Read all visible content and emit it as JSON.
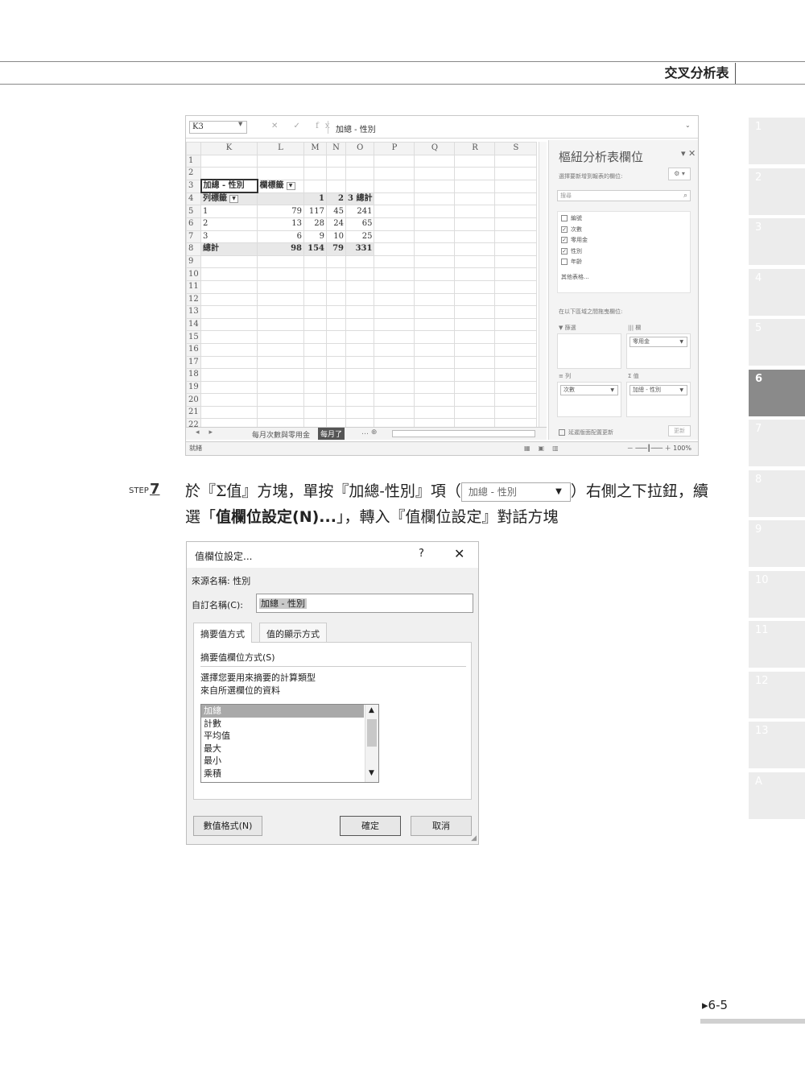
{
  "header": {
    "title": "交叉分析表"
  },
  "chapter_tabs": [
    "1",
    "2",
    "3",
    "4",
    "5",
    "6",
    "7",
    "8",
    "9",
    "10",
    "11",
    "12",
    "13",
    "A"
  ],
  "chapter_active": "6",
  "excel": {
    "name_box": "K3",
    "formula_icons": "✕ ✓ fx",
    "formula_text": "加總 - 性別",
    "col_headers": [
      "K",
      "L",
      "M",
      "N",
      "O",
      "P",
      "Q",
      "R",
      "S"
    ],
    "rows": [
      {
        "n": "1",
        "c": [
          "",
          "",
          "",
          "",
          ""
        ]
      },
      {
        "n": "2",
        "c": [
          "",
          "",
          "",
          "",
          ""
        ]
      },
      {
        "n": "3",
        "c": [
          "加總 - 性別",
          "欄標籤",
          "",
          "",
          ""
        ]
      },
      {
        "n": "4",
        "c": [
          "列標籤",
          "",
          "1",
          "2",
          "3 總計"
        ]
      },
      {
        "n": "5",
        "c": [
          "1",
          "79",
          "117",
          "45",
          "241"
        ]
      },
      {
        "n": "6",
        "c": [
          "2",
          "13",
          "28",
          "24",
          "65"
        ]
      },
      {
        "n": "7",
        "c": [
          "3",
          "6",
          "9",
          "10",
          "25"
        ]
      },
      {
        "n": "8",
        "c": [
          "總計",
          "98",
          "154",
          "79",
          "331"
        ]
      },
      {
        "n": "9"
      },
      {
        "n": "10"
      },
      {
        "n": "11"
      },
      {
        "n": "12"
      },
      {
        "n": "13"
      },
      {
        "n": "14"
      },
      {
        "n": "15"
      },
      {
        "n": "16"
      },
      {
        "n": "17"
      },
      {
        "n": "18"
      },
      {
        "n": "19"
      },
      {
        "n": "20"
      },
      {
        "n": "21"
      },
      {
        "n": "22"
      }
    ],
    "sheet_tabs": [
      "每月次數與零用金",
      "每月了"
    ],
    "status": "就緒",
    "zoom": "100%",
    "pane": {
      "title": "樞紐分析表欄位",
      "subtitle": "選擇要新增到報表的欄位:",
      "search_placeholder": "搜尋",
      "fields": [
        {
          "label": "編號",
          "checked": false
        },
        {
          "label": "次數",
          "checked": true
        },
        {
          "label": "零用金",
          "checked": true
        },
        {
          "label": "性別",
          "checked": true
        },
        {
          "label": "年齡",
          "checked": false
        }
      ],
      "more_tables": "其他表格...",
      "areas_label": "在以下區域之間拖曳欄位:",
      "filters_label": "▼ 篩選",
      "columns_label": "||| 欄",
      "columns_chip": "零用金",
      "rows_label": "≡ 列",
      "rows_chip": "次數",
      "values_label": "Σ 值",
      "values_chip": "加總 - 性別",
      "defer_label": "延遲版面配置更新",
      "update_label": "更新"
    }
  },
  "step": {
    "label": "STEP",
    "number": "7",
    "text_part1": "於『Σ值』方塊，單按『加總-性別』項（",
    "chip_text": "加總 - 性別",
    "text_part2": "）右側之下拉鈕，續選「",
    "bold_text": "值欄位設定(N)...",
    "text_part3": "」，轉入『值欄位設定』對話方塊"
  },
  "dialog": {
    "title": "值欄位設定...",
    "help": "?",
    "close": "✕",
    "source_label": "來源名稱:  性別",
    "custom_label": "自訂名稱(C):",
    "custom_value": "加總 - 性別",
    "tab1": "摘要值方式",
    "tab2": "值的顯示方式",
    "section": "摘要值欄位方式(S)",
    "desc1": "選擇您要用來摘要的計算類型",
    "desc2": "來自所選欄位的資料",
    "options": [
      "加總",
      "計數",
      "平均值",
      "最大",
      "最小",
      "乘積"
    ],
    "selected": "加總",
    "number_format": "數值格式(N)",
    "ok": "確定",
    "cancel": "取消"
  },
  "page_number": "6-5"
}
